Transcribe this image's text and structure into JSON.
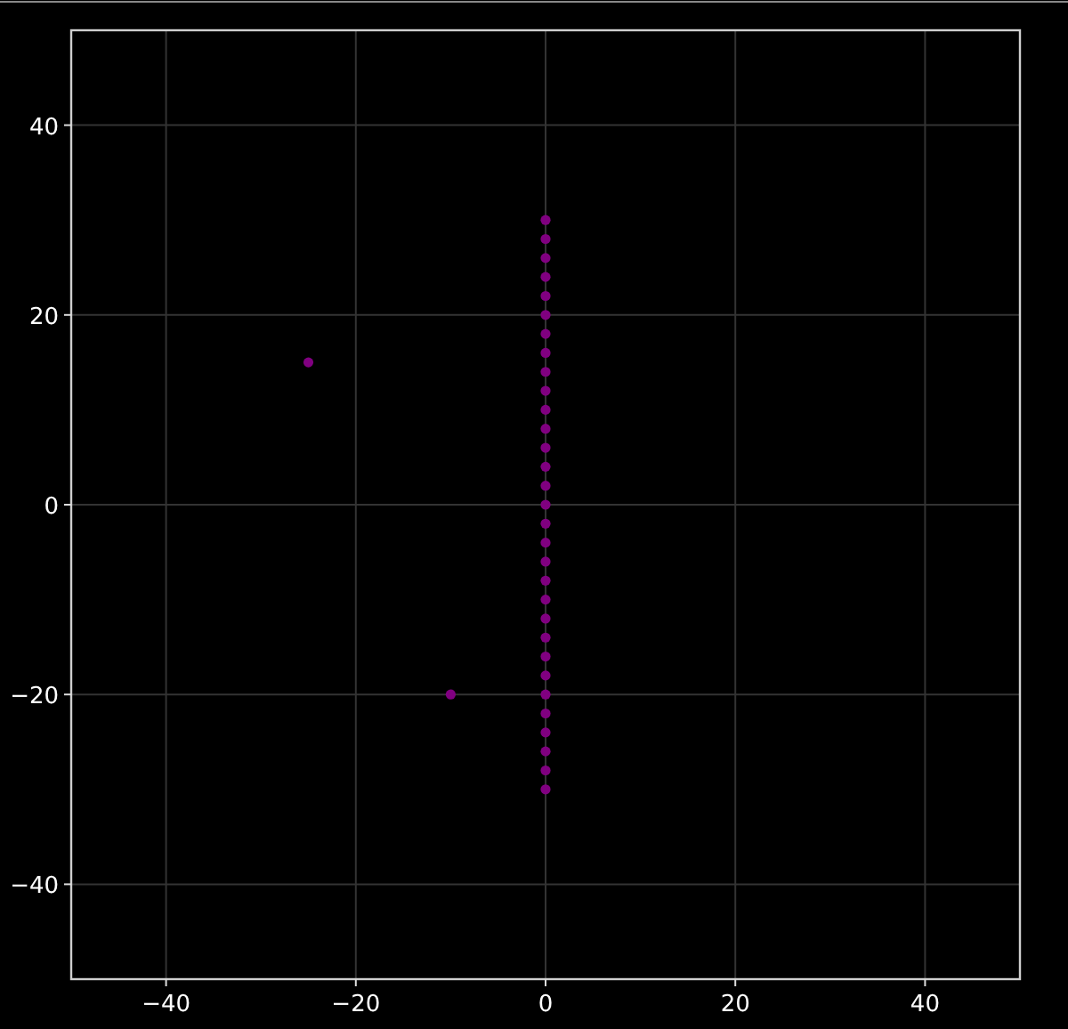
{
  "chart": {
    "chart_data": {
      "type": "scatter",
      "x": [
        0,
        0,
        0,
        0,
        0,
        0,
        0,
        0,
        0,
        0,
        0,
        0,
        0,
        0,
        0,
        0,
        0,
        0,
        0,
        0,
        0,
        0,
        0,
        0,
        0,
        0,
        0,
        0,
        0,
        0,
        0,
        -25,
        -10
      ],
      "series": [
        {
          "color": "#800080",
          "values": [
            -30,
            -28,
            -26,
            -24,
            -22,
            -20,
            -18,
            -16,
            -14,
            -12,
            -10,
            -8,
            -6,
            -4,
            -2,
            0,
            2,
            4,
            6,
            8,
            10,
            12,
            14,
            16,
            18,
            20,
            22,
            24,
            26,
            28,
            30,
            15,
            -20
          ]
        }
      ],
      "grid": true,
      "xlim": [
        -50,
        50
      ],
      "ylim": [
        -50,
        50
      ],
      "xticks": [
        {
          "value": -40,
          "label": "−40"
        },
        {
          "value": -20,
          "label": "−20"
        },
        {
          "value": 0,
          "label": "0"
        },
        {
          "value": 20,
          "label": "20"
        },
        {
          "value": 40,
          "label": "40"
        }
      ],
      "yticks": [
        {
          "value": -40,
          "label": "−40"
        },
        {
          "value": -20,
          "label": "−20"
        },
        {
          "value": 0,
          "label": "0"
        },
        {
          "value": 20,
          "label": "20"
        },
        {
          "value": 40,
          "label": "40"
        }
      ]
    }
  }
}
